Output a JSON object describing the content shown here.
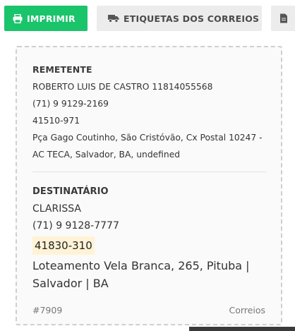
{
  "toolbar": {
    "print_label": "IMPRIMIR",
    "labels_label": "ETIQUETAS DOS CORREIOS",
    "print_color": "#1ac46a",
    "icons": [
      "printer-icon",
      "truck-icon",
      "document-icon"
    ]
  },
  "sender": {
    "heading": "REMETENTE",
    "name": "ROBERTO LUIS DE CASTRO 11814055568",
    "phone": "(71) 9 9129-2169",
    "cep": "41510-971",
    "address_line1": "Pça Gago Coutinho, São Cristóvão, Cx Postal 10247 -",
    "address_line2": "AC TECA, Salvador, BA, undefined"
  },
  "recipient": {
    "heading": "DESTINATÁRIO",
    "name": "CLARISSA",
    "phone": "(71) 9 9128-7777",
    "cep": "41830-310",
    "address": "Loteamento Vela Branca, 265, Pituba | Salvador | BA"
  },
  "footer": {
    "order_id": "#7909",
    "carrier": "Correios"
  }
}
